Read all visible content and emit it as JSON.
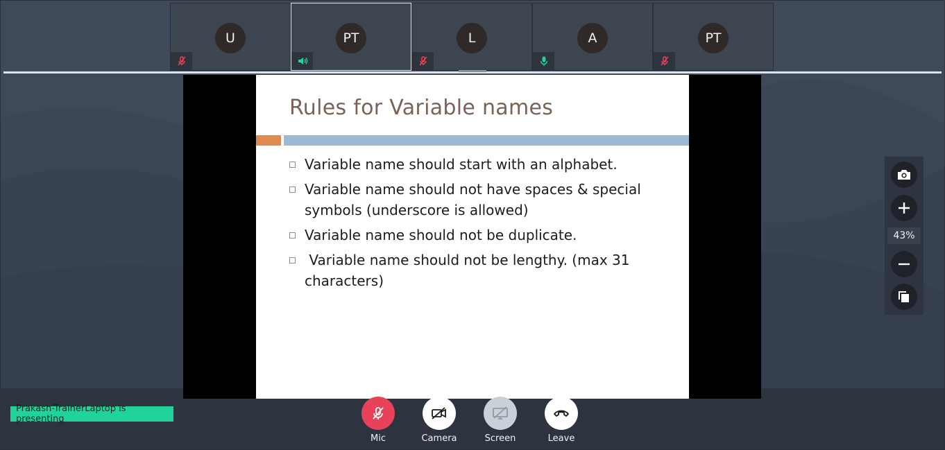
{
  "participants": [
    {
      "initials": "U",
      "mic": "muted",
      "active": false
    },
    {
      "initials": "PT",
      "mic": "speaking",
      "active": true
    },
    {
      "initials": "L",
      "mic": "muted",
      "active": false
    },
    {
      "initials": "A",
      "mic": "on",
      "active": false
    },
    {
      "initials": "PT",
      "mic": "muted",
      "active": false
    }
  ],
  "slide": {
    "title": "Rules for Variable names",
    "bullets": [
      "Variable name should start with an alphabet.",
      "Variable name should not have spaces & special symbols (underscore is allowed)",
      "Variable name should not be duplicate.",
      " Variable name should not be lengthy. (max 31 characters)"
    ]
  },
  "zoom": {
    "level": "43%"
  },
  "presenting_text": "Prakash-TrainerLaptop is presenting",
  "controls": {
    "mic_label": "Mic",
    "camera_label": "Camera",
    "screen_label": "Screen",
    "leave_label": "Leave"
  },
  "colors": {
    "muted": "#e8425a",
    "speaking": "#1fd39a",
    "mic_button": "#e8425a",
    "presenting_badge": "#1fd39a"
  }
}
